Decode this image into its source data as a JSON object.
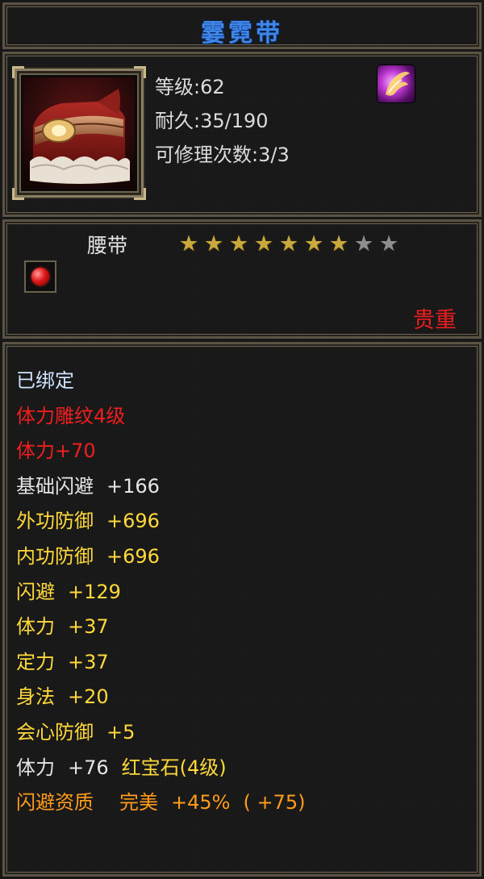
{
  "item": {
    "name": "霎霓带",
    "level_line": "等级:62",
    "durability_line": "耐久:35/190",
    "repair_line": "可修理次数:3/3",
    "type": "腰带",
    "rarity": "贵重",
    "stars": {
      "filled": 7,
      "total": 9
    }
  },
  "icons": {
    "item": "red-fur-belt-icon",
    "skill": "pink-phoenix-skill-icon",
    "gem": "red-gem-icon",
    "star_filled": "star-filled-icon",
    "star_empty": "star-empty-icon"
  },
  "stats": {
    "bound": "已绑定",
    "engrave": "体力雕纹4级",
    "engrave_bonus": "体力+70",
    "base_dodge": {
      "name": "基础闪避",
      "value": "+166"
    },
    "outer_def": {
      "name": "外功防御",
      "value": "+696"
    },
    "inner_def": {
      "name": "内功防御",
      "value": "+696"
    },
    "dodge": {
      "name": "闪避",
      "value": "+129"
    },
    "vitality": {
      "name": "体力",
      "value": "+37"
    },
    "focus": {
      "name": "定力",
      "value": "+37"
    },
    "agility": {
      "name": "身法",
      "value": "+20"
    },
    "crit_def": {
      "name": "会心防御",
      "value": "+5"
    },
    "gem_bonus": {
      "name": "体力",
      "value": "+76",
      "gem": "红宝石(4级)"
    },
    "quality": {
      "name": "闪避资质",
      "grade": "完美",
      "value": "+45%",
      "extra": "( +75)"
    }
  },
  "colors": {
    "title": "#3f86e9",
    "bound": "#cfe3ff",
    "red": "#f01e1e",
    "yellow": "#ffd93a",
    "orange": "#ff9c1a",
    "star_filled": "#c9a93d",
    "star_empty": "#8e8e8e",
    "rarity": "#ee1c1c"
  }
}
